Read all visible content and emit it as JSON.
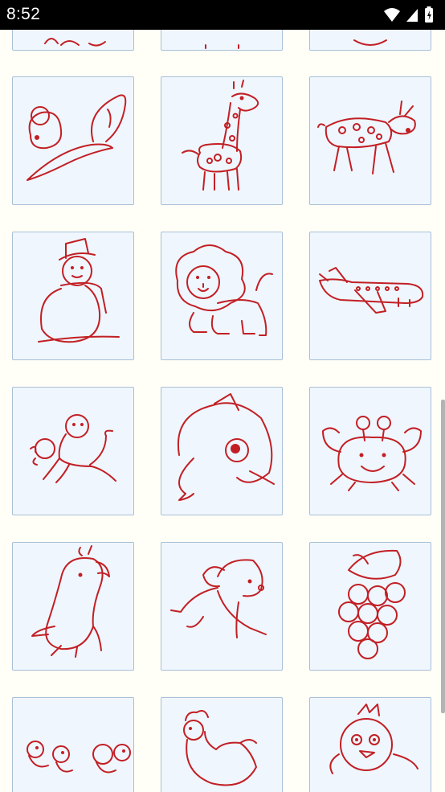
{
  "status_bar": {
    "time": "8:52",
    "icons": [
      "wifi-icon",
      "cellular-signal-icon",
      "battery-charging-icon"
    ]
  },
  "grid": {
    "columns": 3,
    "items": [
      {
        "drawing": "partial-drawing"
      },
      {
        "drawing": "partial-drawing"
      },
      {
        "drawing": "partial-drawing"
      },
      {
        "drawing": "squirrel"
      },
      {
        "drawing": "giraffe"
      },
      {
        "drawing": "deer"
      },
      {
        "drawing": "snowman"
      },
      {
        "drawing": "lion"
      },
      {
        "drawing": "airplane"
      },
      {
        "drawing": "monkey"
      },
      {
        "drawing": "dolphin"
      },
      {
        "drawing": "crab"
      },
      {
        "drawing": "parrot"
      },
      {
        "drawing": "dog"
      },
      {
        "drawing": "grapes"
      },
      {
        "drawing": "chicks"
      },
      {
        "drawing": "hen"
      },
      {
        "drawing": "bird"
      }
    ]
  },
  "colors": {
    "line_art": "#c21f24",
    "card_background": "#eff6fe",
    "card_border": "#a9c0d6",
    "page_background": "#fffef7"
  }
}
